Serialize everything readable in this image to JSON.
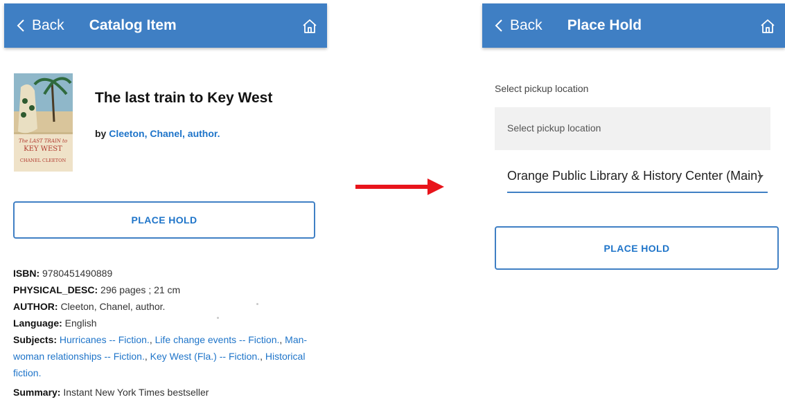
{
  "colors": {
    "appbar": "#3f7fc4",
    "link": "#1e74c9",
    "arrow": "#e8141b"
  },
  "left": {
    "appbar": {
      "back": "Back",
      "title": "Catalog Item",
      "home_icon": "home-icon"
    },
    "cover": {
      "line1": "The LAST TRAIN to",
      "line2": "KEY WEST",
      "author": "CHANEL CLEETON"
    },
    "book_title": "The last train to Key West",
    "by_label": "by",
    "author_link": "Cleeton, Chanel, author.",
    "place_hold": "PLACE HOLD",
    "details": {
      "isbn_label": "ISBN:",
      "isbn": "9780451490889",
      "physical_label": "PHYSICAL_DESC:",
      "physical": "296 pages ; 21 cm",
      "author_label": "AUTHOR:",
      "author": "Cleeton, Chanel, author.",
      "language_label": "Language:",
      "language": "English",
      "subjects_label": "Subjects:",
      "subjects": [
        "Hurricanes -- Fiction.",
        "Life change events -- Fiction.",
        "Man-woman relationships -- Fiction.",
        "Key West (Fla.) -- Fiction.",
        "Historical fiction."
      ]
    },
    "summary_label": "Summary:",
    "summary": "Instant New York Times bestseller"
  },
  "right": {
    "appbar": {
      "back": "Back",
      "title": "Place Hold",
      "home_icon": "home-icon"
    },
    "pickup_label": "Select pickup location",
    "pickup_placeholder": "Select pickup location",
    "selected_location": "Orange Public Library & History Center (Main)",
    "place_hold": "PLACE HOLD"
  }
}
